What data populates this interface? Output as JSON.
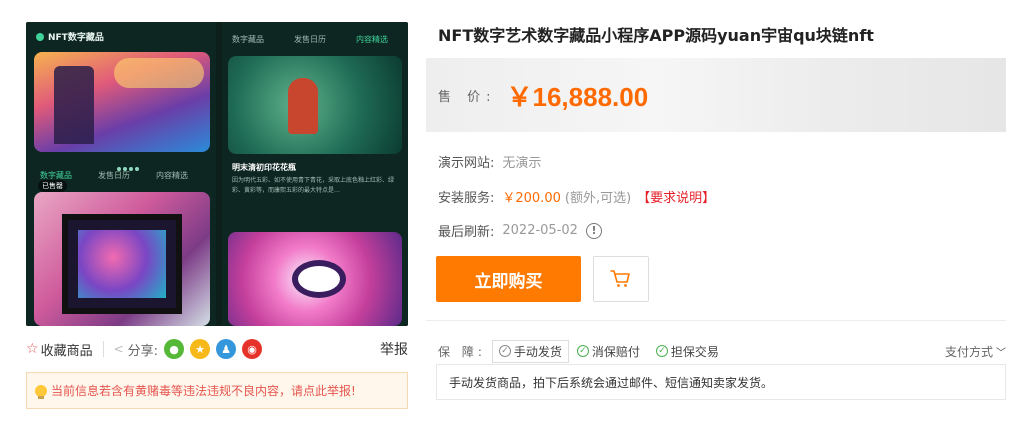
{
  "image": {
    "left_phone": {
      "brand": "NFT数字藏品",
      "tabs": [
        "数字藏品",
        "发售日历",
        "内容精选"
      ],
      "badge": "已售罄"
    },
    "right_phone": {
      "tabs": [
        "数字藏品",
        "发售日历",
        "内容精选"
      ],
      "card_title": "明末清初印花花瓶",
      "card_text": "因为明代五彩、如不使用青下青花，采取上底色釉上红彩、绿彩、黄彩等，而康熙五彩的最大特点是…"
    }
  },
  "actions": {
    "favorite_label": "收藏商品",
    "share_label": "分享:",
    "report_label": "举报"
  },
  "notice": "当前信息若含有黄赌毒等违法违规不良内容，请点此举报!",
  "product": {
    "title": "NFT数字艺术数字藏品小程序APP源码yuan宇宙qu块链nft",
    "price_label": "售 价:",
    "price": "￥16,888.00",
    "demo_label": "演示网站:",
    "demo_value": "无演示",
    "install_label": "安装服务:",
    "install_price": "￥200.00",
    "install_note": "(额外,可选)",
    "install_link": "【要求说明】",
    "refresh_label": "最后刷新:",
    "refresh_date": "2022-05-02",
    "buy_button": "立即购买"
  },
  "guarantee": {
    "label": "保 障:",
    "items": [
      "手动发货",
      "消保赔付",
      "担保交易"
    ],
    "payment_label": "支付方式",
    "description": "手动发货商品，拍下后系统会通过邮件、短信通知卖家发货。"
  },
  "colors": {
    "accent": "#ff7a00",
    "price": "#ff6a00",
    "warning": "#e5222a",
    "check": "#4caf50"
  }
}
